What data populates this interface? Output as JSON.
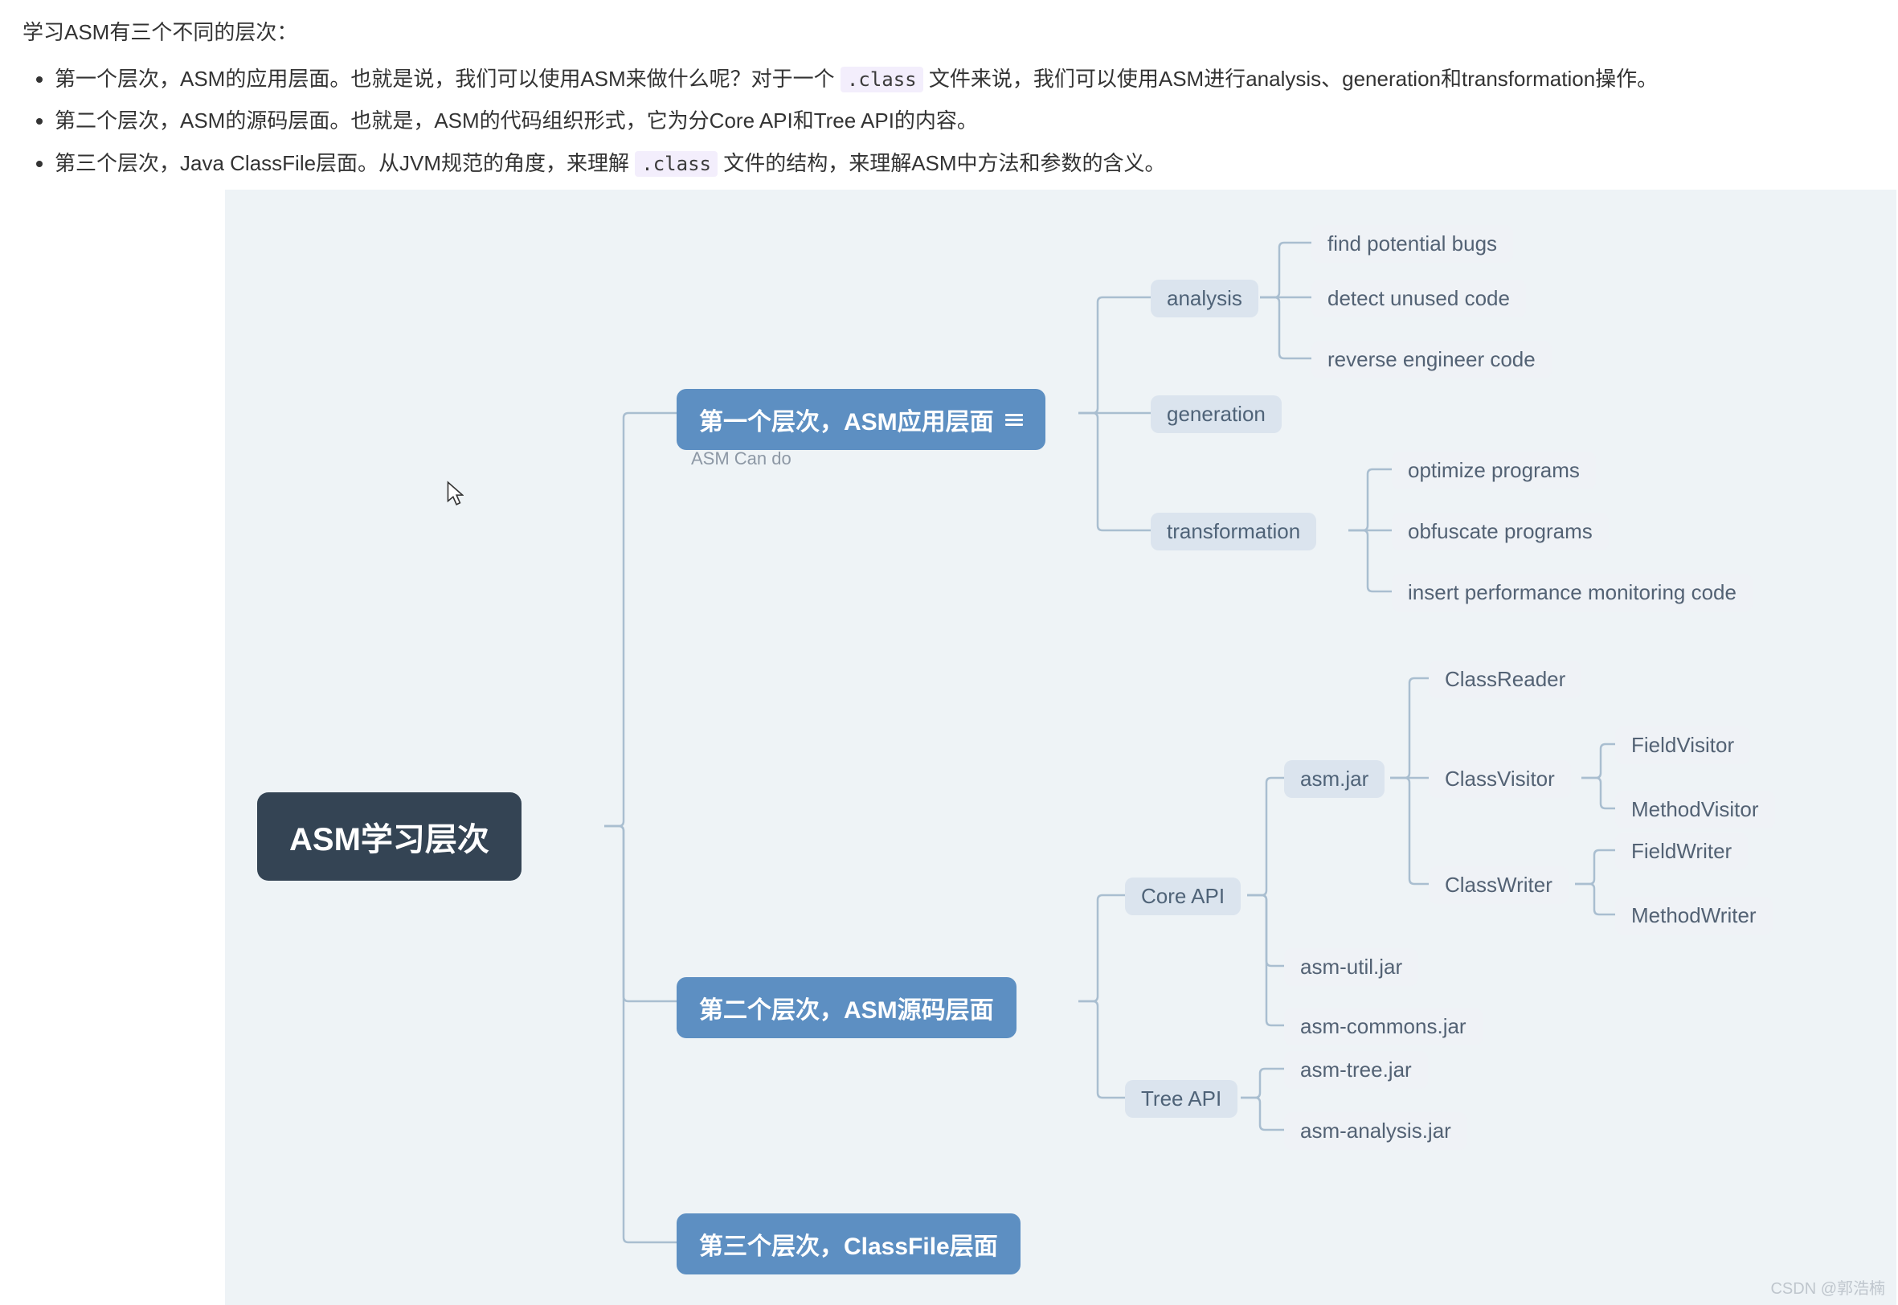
{
  "intro": {
    "title": "学习ASM有三个不同的层次：",
    "bullet1_a": "第一个层次，ASM的应用层面。也就是说，我们可以使用ASM来做什么呢？对于一个 ",
    "bullet1_code": ".class",
    "bullet1_b": " 文件来说，我们可以使用ASM进行analysis、generation和transformation操作。",
    "bullet2": "第二个层次，ASM的源码层面。也就是，ASM的代码组织形式，它为分Core API和Tree API的内容。",
    "bullet3_a": "第三个层次，Java ClassFile层面。从JVM规范的角度，来理解 ",
    "bullet3_code": ".class",
    "bullet3_b": " 文件的结构，来理解ASM中方法和参数的含义。"
  },
  "root": "ASM学习层次",
  "level1": {
    "label": "第一个层次，ASM应用层面",
    "note": "ASM Can do",
    "children": {
      "analysis": {
        "label": "analysis",
        "items": [
          "find potential bugs",
          "detect unused code",
          "reverse engineer code"
        ]
      },
      "generation": {
        "label": "generation"
      },
      "transformation": {
        "label": "transformation",
        "items": [
          "optimize programs",
          "obfuscate programs",
          "insert performance monitoring code"
        ]
      }
    }
  },
  "level2": {
    "label": "第二个层次，ASM源码层面",
    "children": {
      "core": {
        "label": "Core API",
        "asmjar": {
          "label": "asm.jar",
          "classReader": "ClassReader",
          "classVisitor": {
            "label": "ClassVisitor",
            "items": [
              "FieldVisitor",
              "MethodVisitor"
            ]
          },
          "classWriter": {
            "label": "ClassWriter",
            "items": [
              "FieldWriter",
              "MethodWriter"
            ]
          }
        },
        "utiljar": "asm-util.jar",
        "commonsjar": "asm-commons.jar"
      },
      "tree": {
        "label": "Tree API",
        "items": [
          "asm-tree.jar",
          "asm-analysis.jar"
        ]
      }
    }
  },
  "level3": {
    "label": "第三个层次，ClassFile层面"
  },
  "watermark": "CSDN @郭浩楠"
}
